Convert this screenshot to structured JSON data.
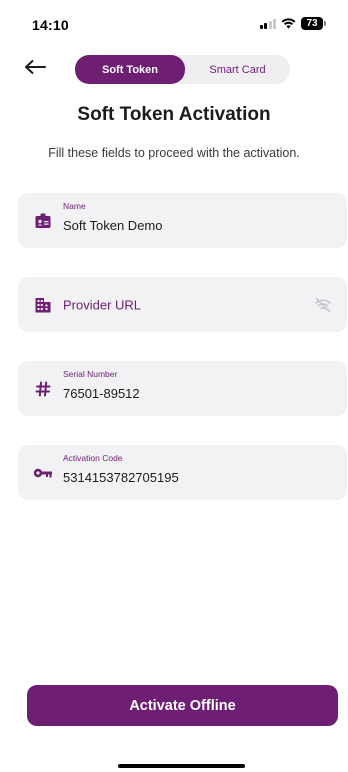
{
  "status_bar": {
    "time": "14:10",
    "battery_level": "73",
    "icons": [
      "signal-icon",
      "wifi-icon",
      "battery-icon"
    ]
  },
  "nav": {
    "back_icon": "back-arrow-icon",
    "tabs": [
      {
        "label": "Soft Token",
        "active": true
      },
      {
        "label": "Smart Card",
        "active": false
      }
    ]
  },
  "page": {
    "title": "Soft Token Activation",
    "subtitle": "Fill these fields to proceed with the activation."
  },
  "fields": {
    "name": {
      "label": "Name",
      "value": "Soft Token Demo",
      "icon": "id-badge-icon"
    },
    "provider_url": {
      "placeholder": "Provider URL",
      "icon": "building-icon",
      "trailing_icon": "wifi-off-icon"
    },
    "serial_number": {
      "label": "Serial Number",
      "value": "76501-89512",
      "icon": "hash-icon"
    },
    "activation_code": {
      "label": "Activation Code",
      "value": "5314153782705195",
      "icon": "key-icon"
    }
  },
  "actions": {
    "activate_label": "Activate Offline"
  },
  "colors": {
    "accent": "#6e1f73",
    "field_background": "#f2f1f4",
    "segment_background": "#efeef1"
  }
}
